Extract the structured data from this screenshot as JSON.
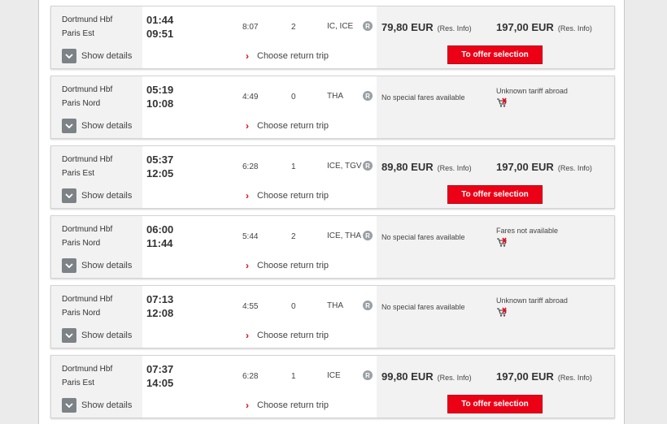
{
  "details_label": "Show details",
  "return_label": "Choose return trip",
  "offer_label": "To offer selection",
  "res_info_label": "(Res. Info)",
  "reservation_badge": "R",
  "colors": {
    "db_red": "#ec0016",
    "chevron_bg": "#7d8287"
  },
  "icons": {
    "details": "chevron-down-icon",
    "return": "chevron-right-icon",
    "cart": "shopping-cart-icon"
  },
  "connections": [
    {
      "from": "Dortmund Hbf",
      "to": "Paris Est",
      "dep": "01:44",
      "arr": "09:51",
      "duration": "8:07",
      "changes": "2",
      "products": "IC, ICE",
      "price1": "79,80 EUR",
      "price2": "197,00 EUR",
      "has_offer": true,
      "no_fare": "",
      "tariff_note": ""
    },
    {
      "from": "Dortmund Hbf",
      "to": "Paris Nord",
      "dep": "05:19",
      "arr": "10:08",
      "duration": "4:49",
      "changes": "0",
      "products": "THA",
      "price1": "",
      "price2": "",
      "has_offer": false,
      "no_fare": "No special fares available",
      "tariff_note": "Unknown tariff abroad"
    },
    {
      "from": "Dortmund Hbf",
      "to": "Paris Est",
      "dep": "05:37",
      "arr": "12:05",
      "duration": "6:28",
      "changes": "1",
      "products": "ICE, TGV",
      "price1": "89,80 EUR",
      "price2": "197,00 EUR",
      "has_offer": true,
      "no_fare": "",
      "tariff_note": ""
    },
    {
      "from": "Dortmund Hbf",
      "to": "Paris Nord",
      "dep": "06:00",
      "arr": "11:44",
      "duration": "5:44",
      "changes": "2",
      "products": "ICE, THA",
      "price1": "",
      "price2": "",
      "has_offer": false,
      "no_fare": "No special fares available",
      "tariff_note": "Fares not available"
    },
    {
      "from": "Dortmund Hbf",
      "to": "Paris Nord",
      "dep": "07:13",
      "arr": "12:08",
      "duration": "4:55",
      "changes": "0",
      "products": "THA",
      "price1": "",
      "price2": "",
      "has_offer": false,
      "no_fare": "No special fares available",
      "tariff_note": "Unknown tariff abroad"
    },
    {
      "from": "Dortmund Hbf",
      "to": "Paris Est",
      "dep": "07:37",
      "arr": "14:05",
      "duration": "6:28",
      "changes": "1",
      "products": "ICE",
      "price1": "99,80 EUR",
      "price2": "197,00 EUR",
      "has_offer": true,
      "no_fare": "",
      "tariff_note": ""
    }
  ]
}
